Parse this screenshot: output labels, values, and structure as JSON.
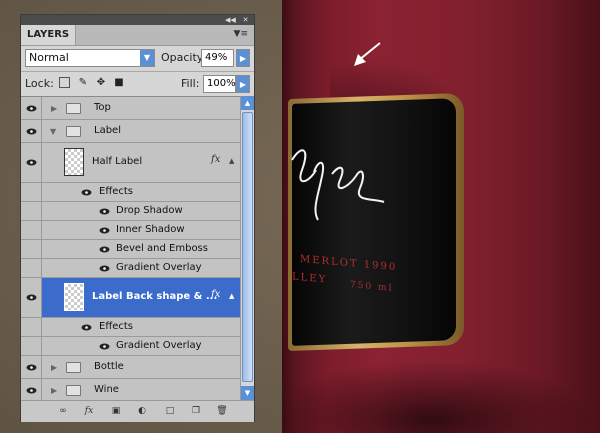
{
  "canvas": {
    "label_line1": "MERLOT 1990",
    "label_line2": "LLEY",
    "label_line3": "750 ml",
    "bottle_color": "#84202f",
    "label_gold": "#d9b36a"
  },
  "panel": {
    "tab": "LAYERS",
    "blend_mode": "Normal",
    "opacity_label": "Opacity:",
    "opacity_value": "49%",
    "lock_label": "Lock:",
    "fill_label": "Fill:",
    "fill_value": "100%",
    "accent": "#3b6ccc"
  },
  "layers": {
    "top": "Top",
    "label": "Label",
    "half_label": "Half Label",
    "effects_1": "Effects",
    "drop_shadow": "Drop Shadow",
    "inner_shadow": "Inner Shadow",
    "bevel": "Bevel and Emboss",
    "gradient_1": "Gradient Overlay",
    "label_back": "Label Back shape & ...",
    "effects_2": "Effects",
    "gradient_2": "Gradient Overlay",
    "bottle": "Bottle",
    "wine": "Wine"
  },
  "icons": [
    "eye-icon",
    "folder-icon",
    "fx-icon",
    "link-icon",
    "mask-icon",
    "adjustment-icon",
    "new-group-icon",
    "new-layer-icon",
    "trash-icon"
  ]
}
